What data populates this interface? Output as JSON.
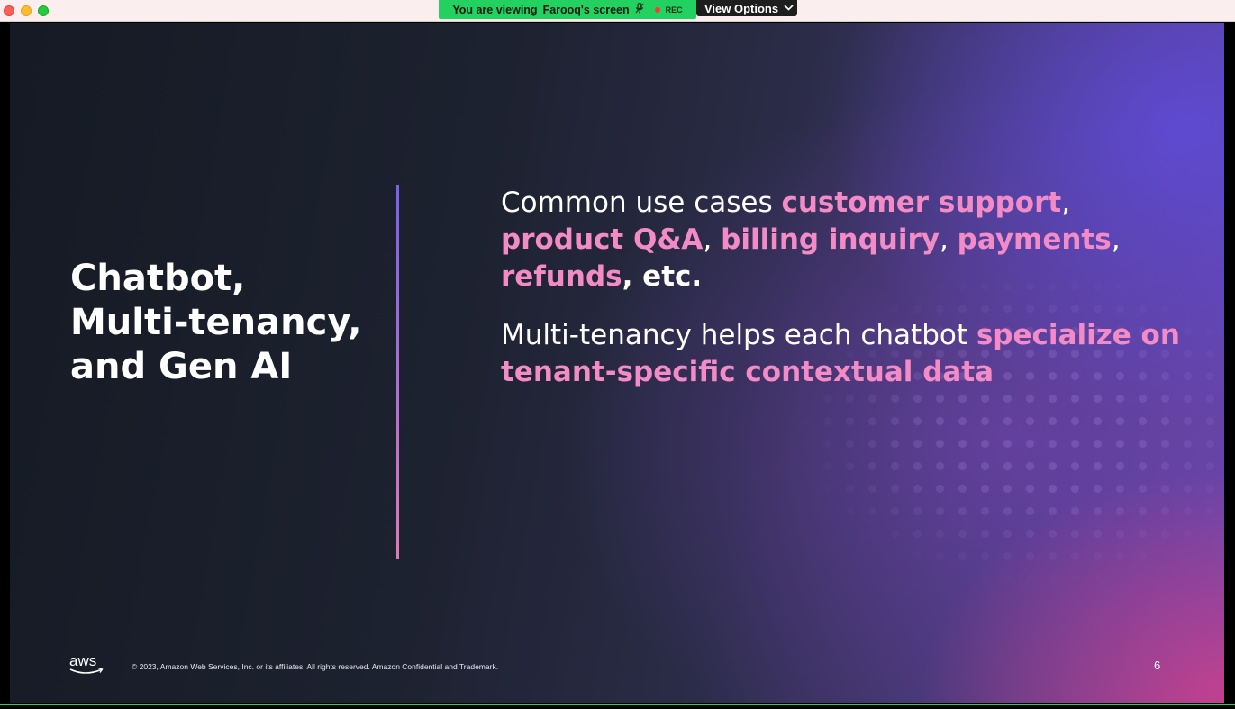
{
  "window": {
    "controls": [
      "close-button",
      "minimize-button",
      "maximize-button"
    ]
  },
  "share_banner": {
    "viewing_prefix": "You are viewing",
    "presenter_screen": "Farooq's screen",
    "rec_label": "REC",
    "view_options_label": "View Options",
    "banner_color": "#23d160"
  },
  "slide": {
    "title_line1": "Chatbot,",
    "title_line2": "Multi-tenancy,",
    "title_line3": "and Gen AI",
    "bullet1": {
      "intro": "Common use cases ",
      "h1": "customer support",
      "s1": ",",
      "h2": "product Q&A",
      "s2": ", ",
      "h3": "billing inquiry",
      "s3": ", ",
      "h4": "payments",
      "s4": ",",
      "h5": "refunds",
      "tail": ", etc."
    },
    "bullet2": {
      "intro": "Multi-tenancy helps each chatbot ",
      "highlight": "specialize on tenant-specific contextual data"
    },
    "highlight_color": "#f38bc7",
    "logo_text": "aws",
    "copyright": "© 2023, Amazon Web Services, Inc. or its affiliates. All rights reserved. Amazon Confidential and Trademark.",
    "page_number": "6"
  }
}
